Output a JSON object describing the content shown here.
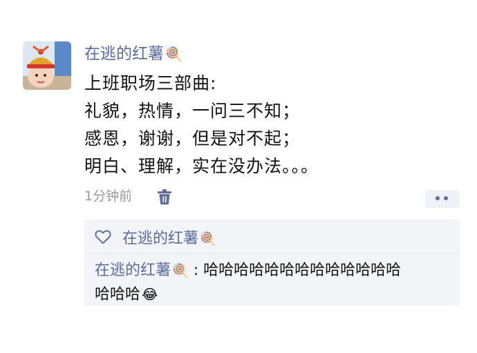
{
  "post": {
    "author": "在逃的红薯",
    "author_emoji": "🍭",
    "lines": [
      "上班职场三部曲:",
      "礼貌，热情，一问三不知；",
      "感恩，谢谢，但是对不起；",
      "明白、理解，实在没办法。。。"
    ],
    "time": "1分钟前"
  },
  "likes": {
    "names": "在逃的红薯",
    "emoji": "🍭"
  },
  "comments": [
    {
      "author": "在逃的红薯",
      "author_emoji": "🍭",
      "separator": ":",
      "text_line1": "哈哈哈哈哈哈哈哈哈哈哈哈哈",
      "text_line2": "哈哈哈",
      "trailing_emoji": "😂"
    }
  ],
  "icons": {
    "delete": "trash-icon",
    "like": "heart-icon",
    "more": "more-dots-icon"
  },
  "colors": {
    "name": "#5a6b9e",
    "text": "#111111",
    "meta": "#9a9a9a",
    "comment_bg": "#f3f4f8"
  }
}
